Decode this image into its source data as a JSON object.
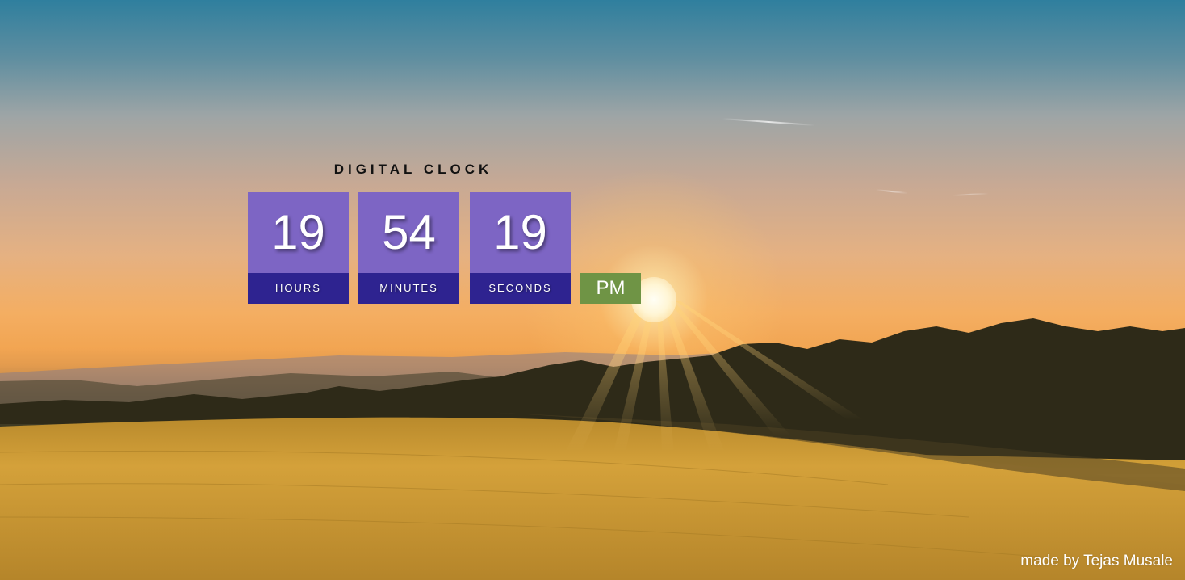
{
  "clock": {
    "title": "DIGITAL CLOCK",
    "hours": {
      "value": "19",
      "label": "HOURS"
    },
    "minutes": {
      "value": "54",
      "label": "MINUTES"
    },
    "seconds": {
      "value": "19",
      "label": "SECONDS"
    },
    "period": "PM"
  },
  "footer": {
    "credit": "made by Tejas Musale"
  },
  "colors": {
    "digit_bg": "#7d65c4",
    "label_bg": "#2e2390",
    "period_bg": "#6f9445",
    "text": "#ffffff"
  }
}
